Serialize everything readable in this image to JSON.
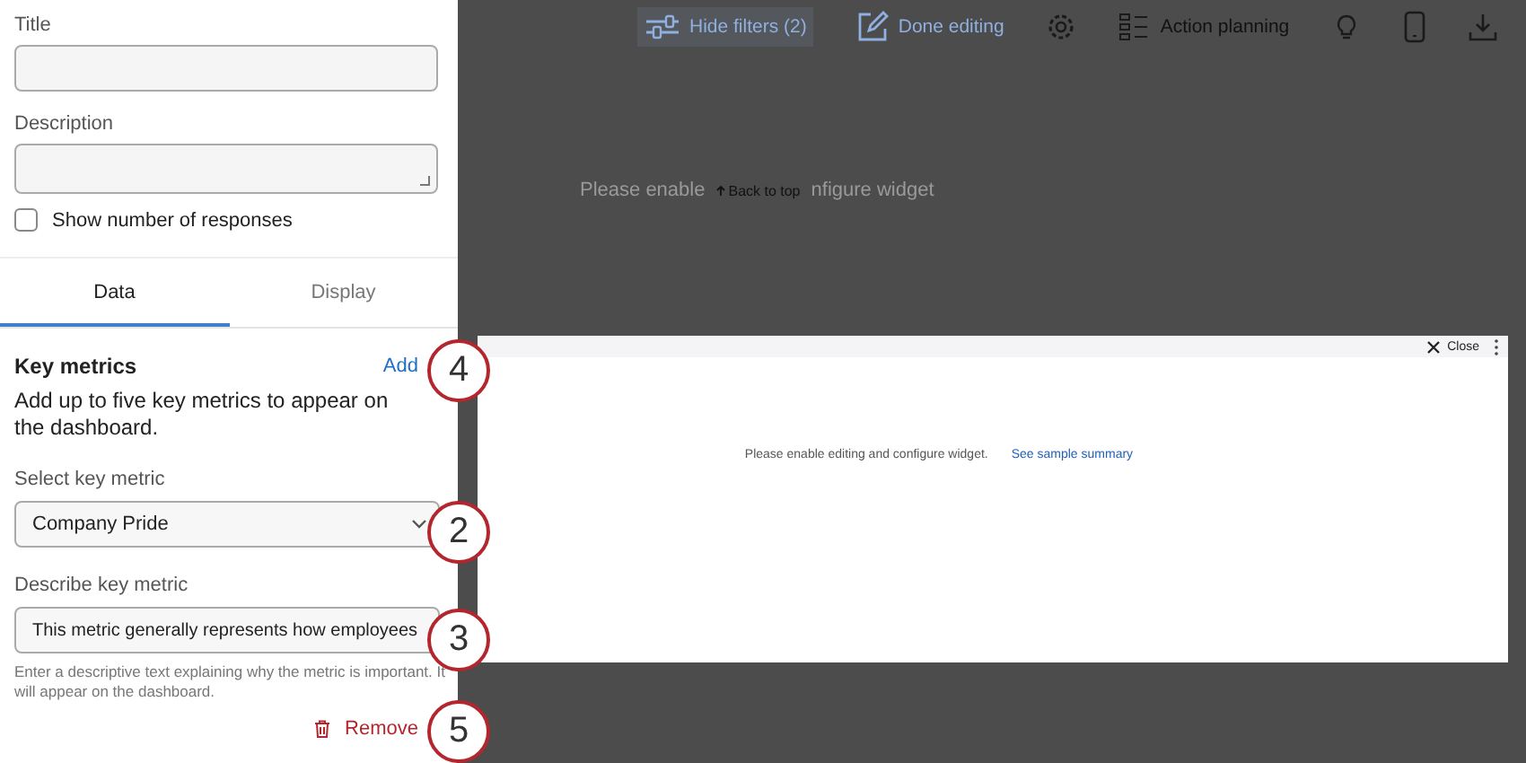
{
  "panel": {
    "title_label": "Title",
    "description_label": "Description",
    "show_responses": {
      "label": "Show number of responses",
      "checked": false
    },
    "tabs": [
      {
        "label": "Data",
        "selected": true
      },
      {
        "label": "Display",
        "selected": false
      }
    ],
    "key_metrics": {
      "heading": "Key metrics",
      "add": "Add",
      "intro": "Add up to five key metrics to appear on the dashboard.",
      "select_label": "Select key metric",
      "select_value": "Company Pride",
      "describe_label": "Describe key metric",
      "describe_value": "This metric generally represents how employees",
      "helper": "Enter a descriptive text explaining why the metric is important. It will appear on the dashboard.",
      "remove": "Remove"
    }
  },
  "toolbar": [
    {
      "kind": "filters",
      "label": "Hide filters (2)"
    },
    {
      "kind": "edit",
      "label": "Done editing"
    },
    {
      "kind": "gear"
    },
    {
      "kind": "planning",
      "label": "Action planning"
    },
    {
      "kind": "bulb"
    },
    {
      "kind": "phone"
    },
    {
      "kind": "download"
    }
  ],
  "background": {
    "message_start": "Please enable",
    "message_end": "nfigure widget",
    "back_to_top": "Back to top"
  },
  "widget": {
    "close": "Close",
    "message": "Please enable editing and configure widget.",
    "link": "See sample summary"
  },
  "callouts": [
    {
      "number": "4"
    },
    {
      "number": "2"
    },
    {
      "number": "3"
    },
    {
      "number": "5"
    }
  ]
}
